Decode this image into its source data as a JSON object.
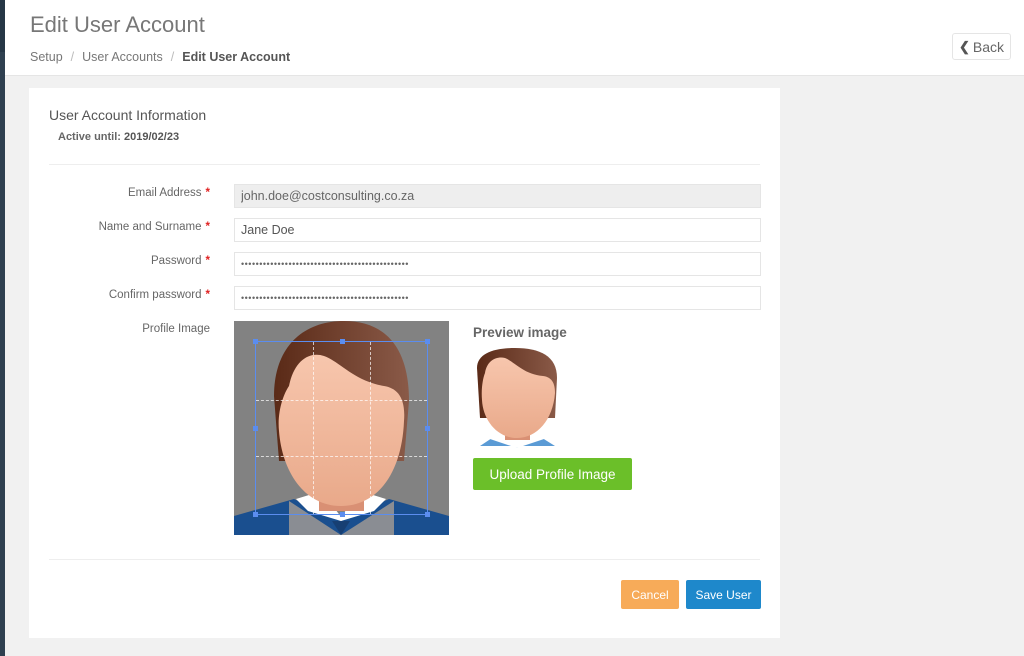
{
  "header": {
    "title": "Edit User Account",
    "breadcrumb": [
      {
        "label": "Setup"
      },
      {
        "label": "User Accounts"
      },
      {
        "label": "Edit User Account"
      }
    ],
    "breadcrumb_separator": "/",
    "back_label": "Back",
    "back_icon": "chevron-left-icon"
  },
  "panel": {
    "title": "User Account Information",
    "active_until_label": "Active until:",
    "active_until_value": "2019/02/23"
  },
  "form": {
    "required_marker": "*",
    "fields": [
      {
        "label": "Email Address",
        "value": "john.doe@costconsulting.co.za",
        "disabled": true
      },
      {
        "label": "Name and Surname",
        "value": "Jane Doe"
      },
      {
        "label": "Password",
        "value": "••••••••••••••••••••••••••••••••••••••••••••••"
      },
      {
        "label": "Confirm password",
        "value": "••••••••••••••••••••••••••••••••••••••••••••••"
      }
    ],
    "profile_image_label": "Profile Image",
    "preview_title": "Preview image",
    "upload_label": "Upload Profile Image"
  },
  "actions": {
    "cancel_label": "Cancel",
    "save_label": "Save User"
  },
  "colors": {
    "upload_button": "#6bbf29",
    "cancel_button": "#f7ab59",
    "save_button": "#1e88cb",
    "required": "#e02222",
    "crop_box": "#5b8def"
  }
}
